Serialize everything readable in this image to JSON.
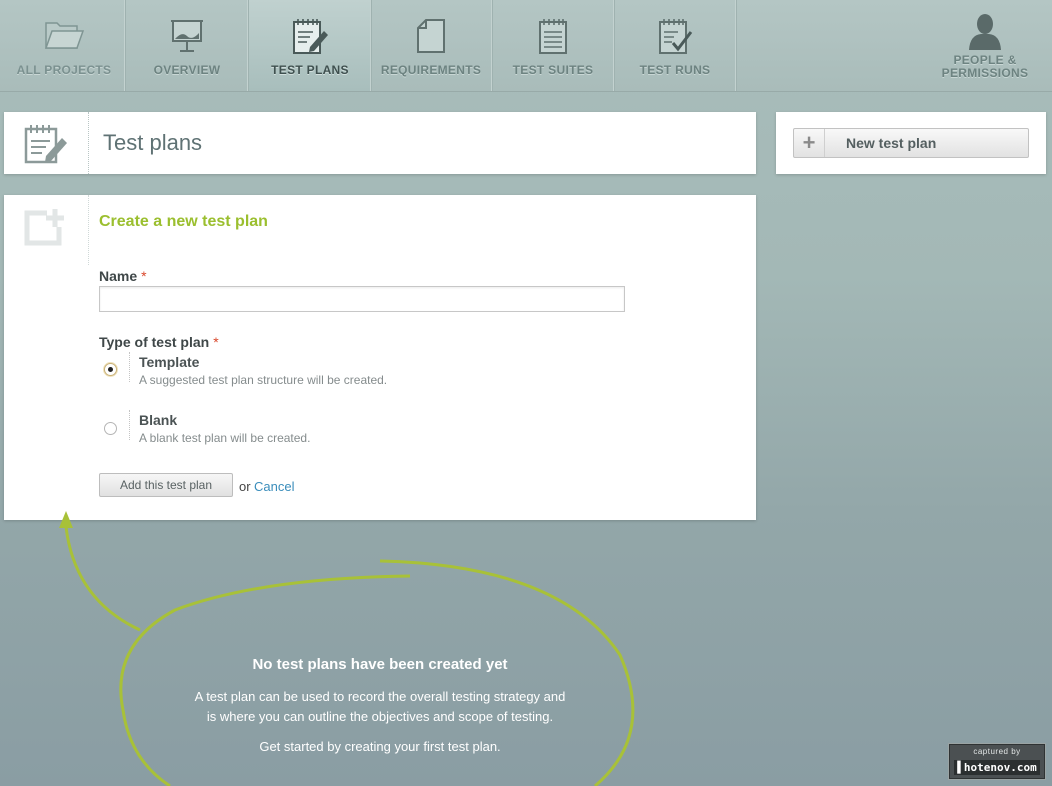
{
  "nav": {
    "tabs": [
      {
        "label": "ALL PROJECTS",
        "icon": "folder-icon"
      },
      {
        "label": "OVERVIEW",
        "icon": "presentation-board-icon"
      },
      {
        "label": "TEST PLANS",
        "icon": "notepad-pen-icon",
        "active": true
      },
      {
        "label": "REQUIREMENTS",
        "icon": "document-icon"
      },
      {
        "label": "TEST SUITES",
        "icon": "notepad-lines-icon"
      },
      {
        "label": "TEST RUNS",
        "icon": "notepad-check-icon"
      }
    ],
    "people": {
      "line1": "PEOPLE &",
      "line2": "PERMISSIONS",
      "icon": "person-silhouette-icon"
    }
  },
  "header": {
    "title": "Test plans",
    "icon": "notepad-pen-icon"
  },
  "actions": {
    "new_plan_label": "New test plan",
    "icon": "plus-icon"
  },
  "form": {
    "title": "Create a new test plan",
    "icon": "add-document-icon",
    "name_label": "Name",
    "name_value": "",
    "type_label": "Type of test plan",
    "required_mark": "*",
    "options": [
      {
        "title": "Template",
        "desc": "A suggested test plan structure will be created.",
        "checked": true
      },
      {
        "title": "Blank",
        "desc": "A blank test plan will be created.",
        "checked": false
      }
    ],
    "submit_label": "Add this test plan",
    "or_text": "or",
    "cancel_label": "Cancel"
  },
  "empty_state": {
    "title": "No test plans have been created yet",
    "line1": "A test plan can be used to record the overall testing strategy and",
    "line2": "is where you can outline the objectives and scope of testing.",
    "line3": "Get started by creating your first test plan."
  },
  "badge": {
    "top": "captured by",
    "bottom": "hotenov.com"
  },
  "colors": {
    "accent_green": "#9bbf2f",
    "link_blue": "#3a8dbb",
    "required_red": "#d9472b"
  }
}
